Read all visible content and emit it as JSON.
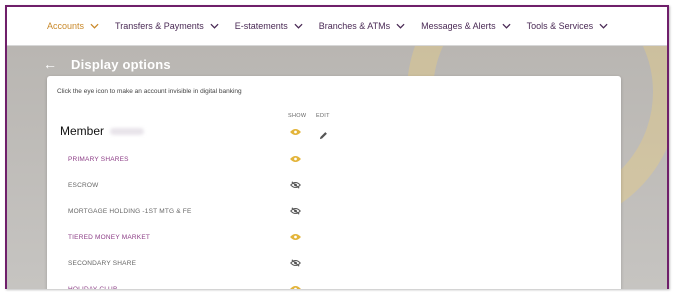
{
  "nav": {
    "items": [
      {
        "label": "Accounts",
        "active": true
      },
      {
        "label": "Transfers & Payments",
        "active": false
      },
      {
        "label": "E-statements",
        "active": false
      },
      {
        "label": "Branches & ATMs",
        "active": false
      },
      {
        "label": "Messages & Alerts",
        "active": false
      },
      {
        "label": "Tools & Services",
        "active": false
      }
    ]
  },
  "page": {
    "back_icon": "back-arrow-icon",
    "title": "Display options"
  },
  "card": {
    "hint": "Click the eye icon to make an account invisible in digital banking",
    "col_show": "SHOW",
    "col_edit": "EDIT",
    "member_label": "Member",
    "member_visible": true
  },
  "accounts": [
    {
      "name": "PRIMARY SHARES",
      "visible": true
    },
    {
      "name": "ESCROW",
      "visible": false
    },
    {
      "name": "MORTGAGE HOLDING -1ST MTG & FE",
      "visible": false
    },
    {
      "name": "TIERED MONEY MARKET",
      "visible": true
    },
    {
      "name": "SECONDARY SHARE",
      "visible": false
    },
    {
      "name": "HOLIDAY CLUB",
      "visible": true
    }
  ],
  "colors": {
    "accent": "#c9892a",
    "brand": "#6f1f6a",
    "visible_icon": "#e3b43a",
    "hidden_icon": "#555555"
  }
}
